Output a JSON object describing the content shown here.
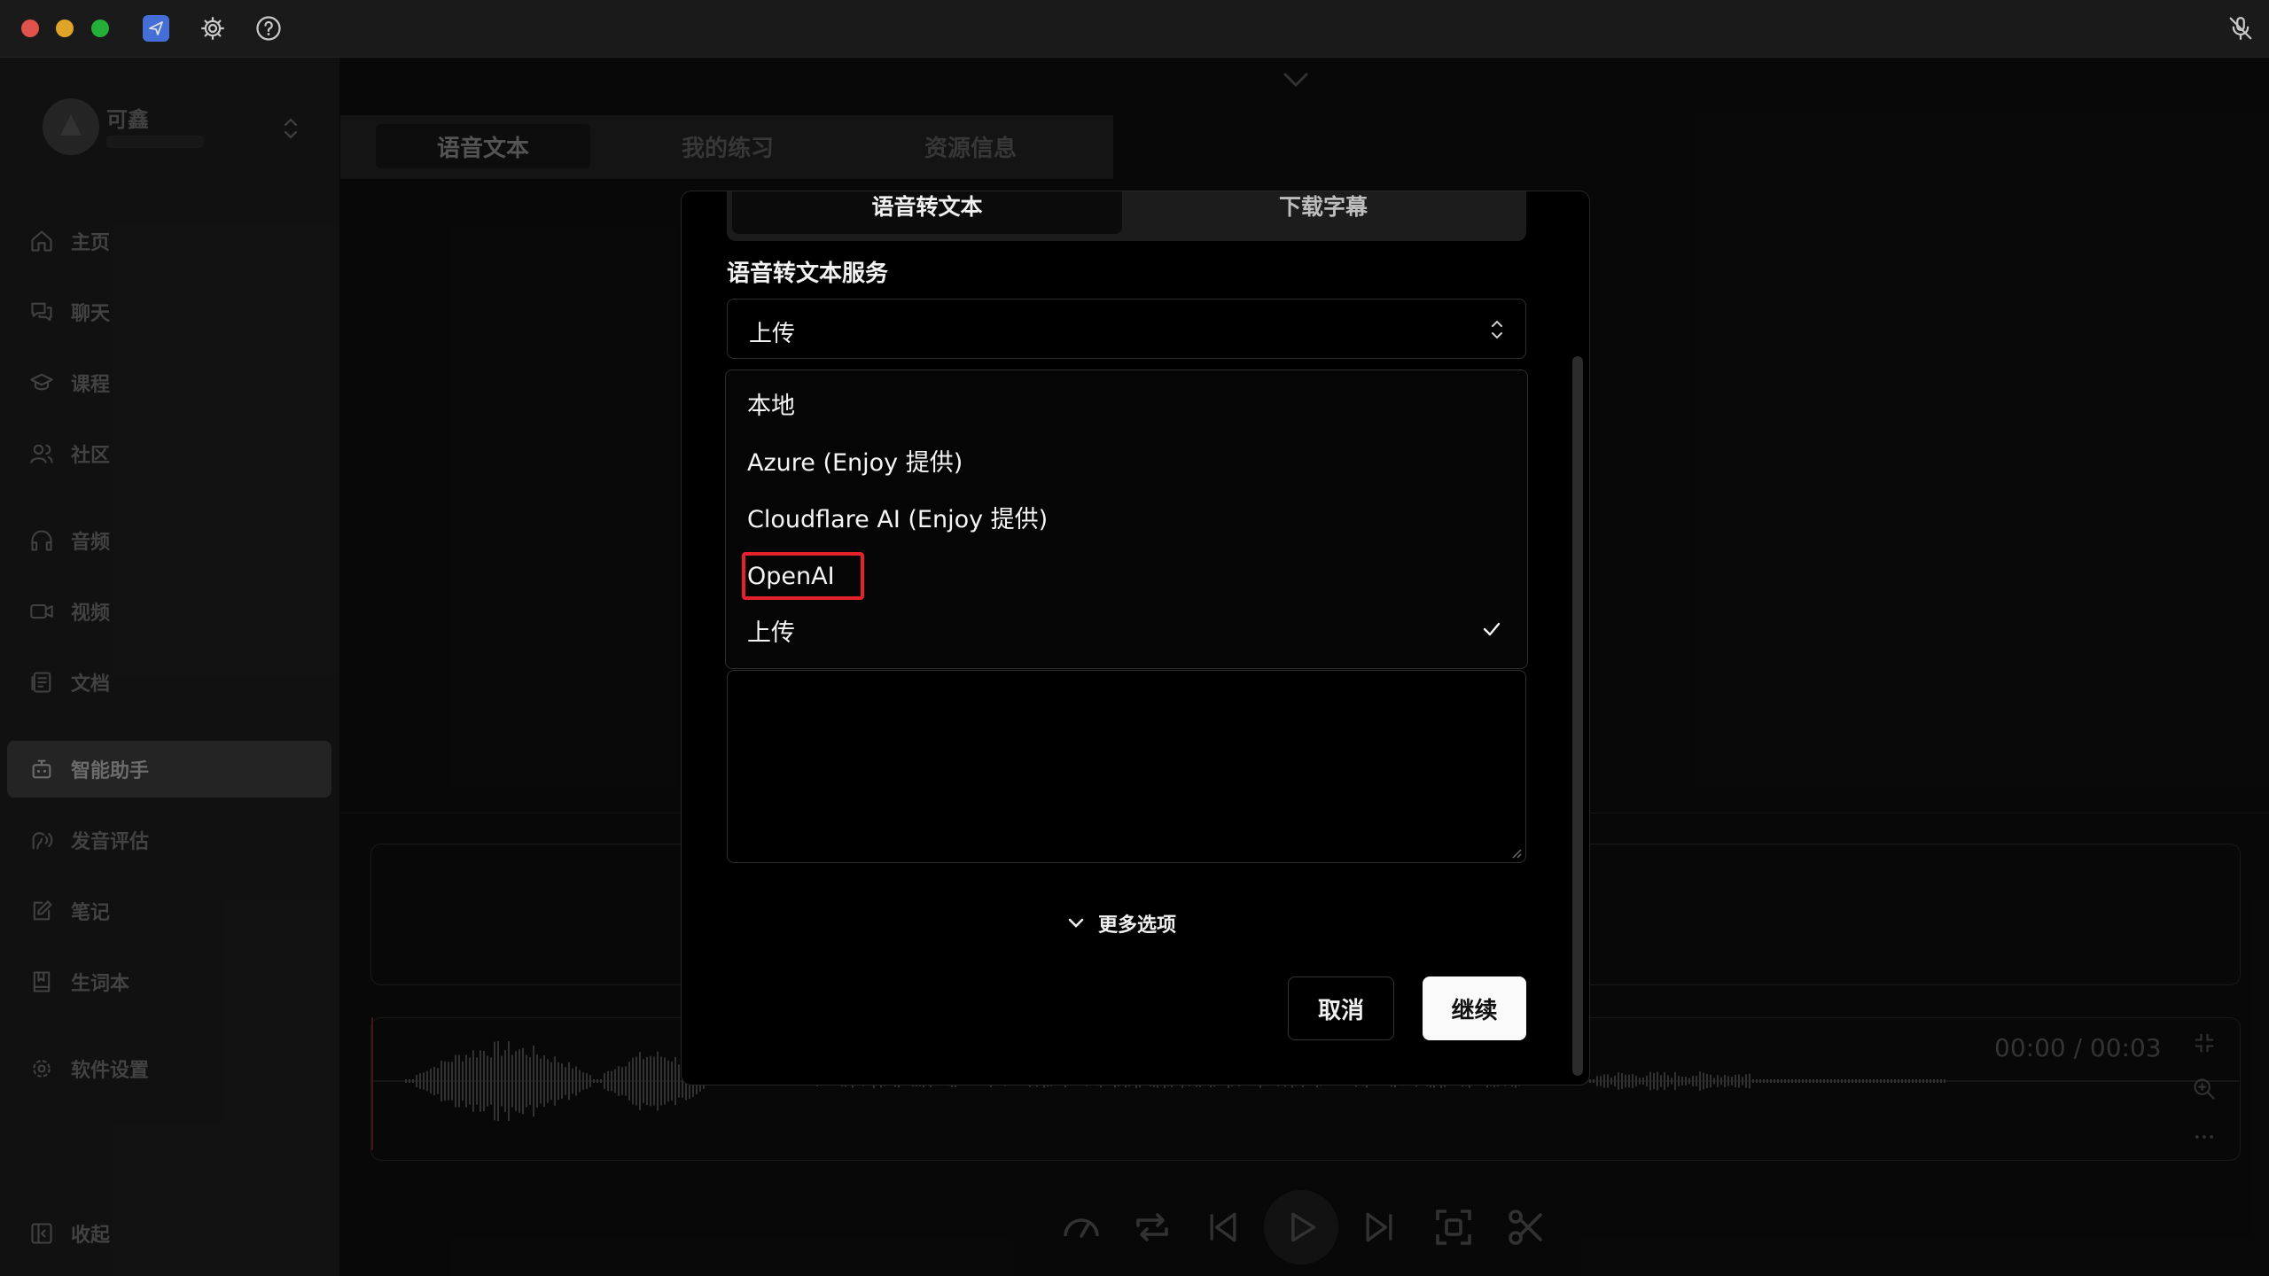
{
  "sidebar": {
    "profile_name": "可鑫",
    "items": [
      {
        "label": "主页",
        "icon": "home-icon"
      },
      {
        "label": "聊天",
        "icon": "chat-icon"
      },
      {
        "label": "课程",
        "icon": "graduation-cap-icon"
      },
      {
        "label": "社区",
        "icon": "users-icon"
      },
      {
        "label": "音频",
        "icon": "headphones-icon"
      },
      {
        "label": "视频",
        "icon": "video-icon"
      },
      {
        "label": "文档",
        "icon": "document-icon"
      },
      {
        "label": "智能助手",
        "icon": "bot-icon"
      },
      {
        "label": "发音评估",
        "icon": "speech-icon"
      },
      {
        "label": "笔记",
        "icon": "note-icon"
      },
      {
        "label": "生词本",
        "icon": "book-icon"
      },
      {
        "label": "软件设置",
        "icon": "settings-icon"
      }
    ],
    "active_item": "智能助手",
    "collapse_label": "收起"
  },
  "tabs": [
    "语音文本",
    "我的练习",
    "资源信息"
  ],
  "active_tab": "语音文本",
  "player": {
    "time": "00:00 / 00:03"
  },
  "modal": {
    "segments": [
      "语音转文本",
      "下载字幕"
    ],
    "active_segment": "语音转文本",
    "field_label": "语音转文本服务",
    "selected_value": "上传",
    "options": [
      "本地",
      "Azure (Enjoy 提供)",
      "Cloudflare AI (Enjoy 提供)",
      "OpenAI",
      "上传"
    ],
    "checked_option": "上传",
    "highlighted_option": "OpenAI",
    "more_options": "更多选项",
    "cancel": "取消",
    "continue": "继续"
  },
  "colors": {
    "highlight_border": "#e5212b",
    "primary_button": "#fafafa",
    "modal_bg": "#000000"
  }
}
